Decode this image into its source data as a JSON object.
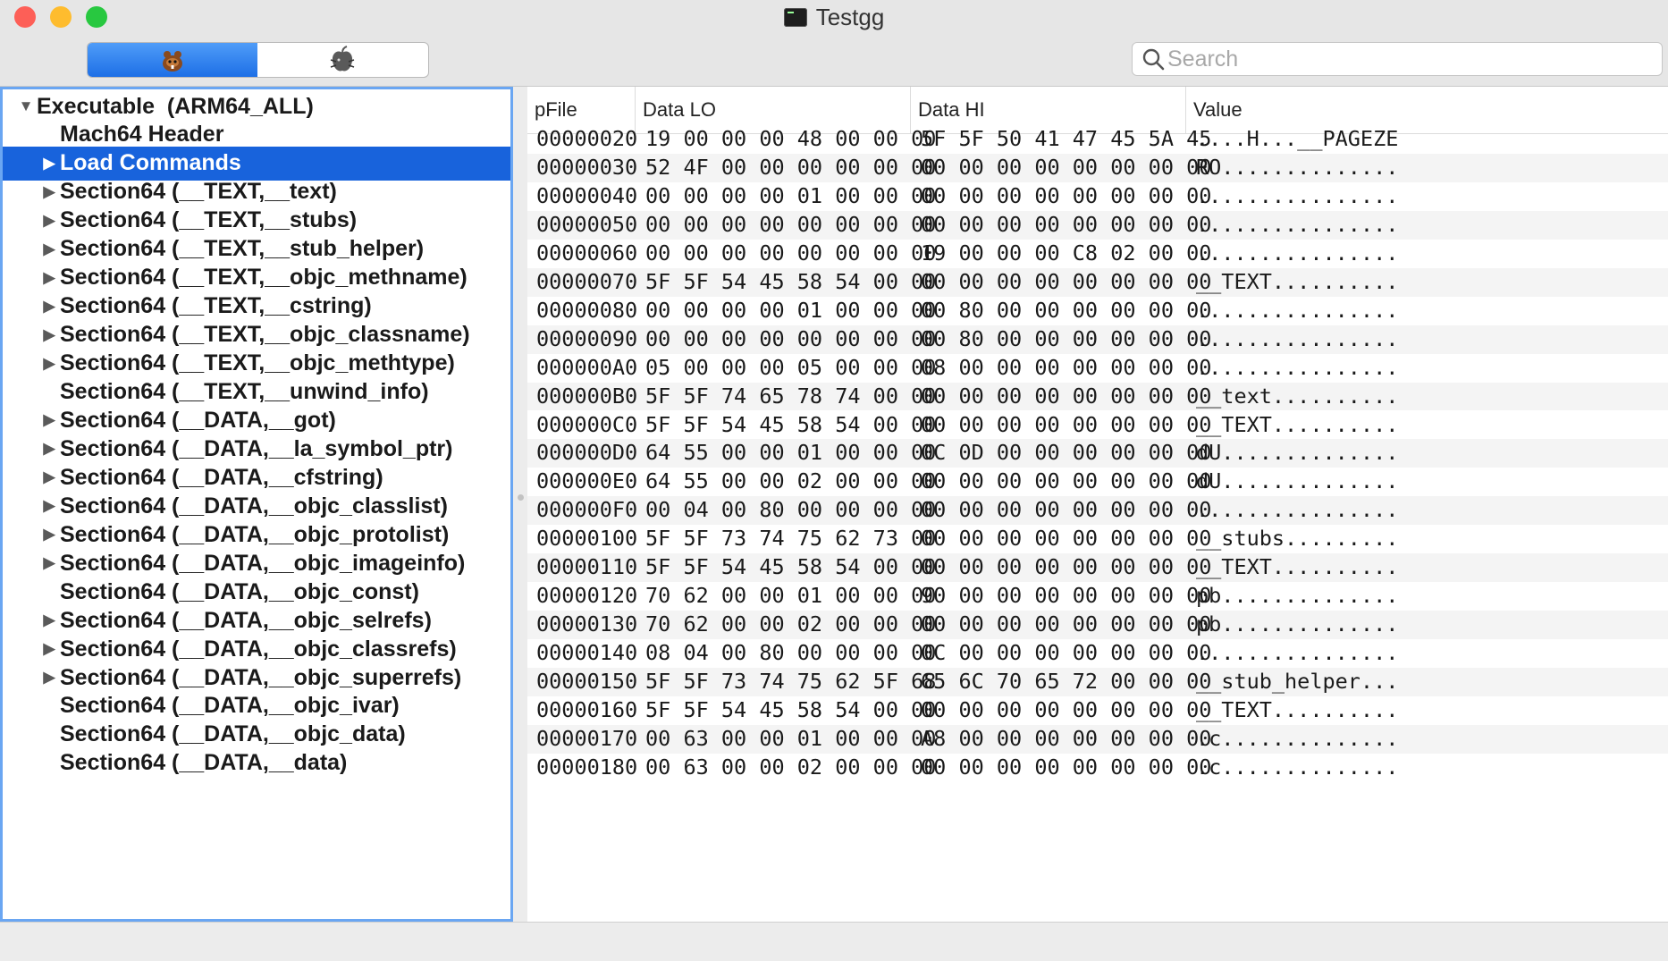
{
  "window": {
    "title": "Testgg"
  },
  "toolbar": {
    "segments": [
      {
        "icon": "rodent-icon",
        "active": true
      },
      {
        "icon": "apple-bug-icon",
        "active": false
      }
    ],
    "search_placeholder": "Search",
    "search_value": ""
  },
  "sidebar": {
    "items": [
      {
        "label": "Executable  (ARM64_ALL)",
        "level": 0,
        "disclosure": "expanded",
        "selected": false
      },
      {
        "label": "Mach64 Header",
        "level": 1,
        "disclosure": "none",
        "selected": false
      },
      {
        "label": "Load Commands",
        "level": 1,
        "disclosure": "collapsed",
        "selected": true
      },
      {
        "label": "Section64 (__TEXT,__text)",
        "level": 1,
        "disclosure": "collapsed",
        "selected": false
      },
      {
        "label": "Section64 (__TEXT,__stubs)",
        "level": 1,
        "disclosure": "collapsed",
        "selected": false
      },
      {
        "label": "Section64 (__TEXT,__stub_helper)",
        "level": 1,
        "disclosure": "collapsed",
        "selected": false
      },
      {
        "label": "Section64 (__TEXT,__objc_methname)",
        "level": 1,
        "disclosure": "collapsed",
        "selected": false
      },
      {
        "label": "Section64 (__TEXT,__cstring)",
        "level": 1,
        "disclosure": "collapsed",
        "selected": false
      },
      {
        "label": "Section64 (__TEXT,__objc_classname)",
        "level": 1,
        "disclosure": "collapsed",
        "selected": false
      },
      {
        "label": "Section64 (__TEXT,__objc_methtype)",
        "level": 1,
        "disclosure": "collapsed",
        "selected": false
      },
      {
        "label": "Section64 (__TEXT,__unwind_info)",
        "level": 1,
        "disclosure": "none",
        "selected": false
      },
      {
        "label": "Section64 (__DATA,__got)",
        "level": 1,
        "disclosure": "collapsed",
        "selected": false
      },
      {
        "label": "Section64 (__DATA,__la_symbol_ptr)",
        "level": 1,
        "disclosure": "collapsed",
        "selected": false
      },
      {
        "label": "Section64 (__DATA,__cfstring)",
        "level": 1,
        "disclosure": "collapsed",
        "selected": false
      },
      {
        "label": "Section64 (__DATA,__objc_classlist)",
        "level": 1,
        "disclosure": "collapsed",
        "selected": false
      },
      {
        "label": "Section64 (__DATA,__objc_protolist)",
        "level": 1,
        "disclosure": "collapsed",
        "selected": false
      },
      {
        "label": "Section64 (__DATA,__objc_imageinfo)",
        "level": 1,
        "disclosure": "collapsed",
        "selected": false
      },
      {
        "label": "Section64 (__DATA,__objc_const)",
        "level": 1,
        "disclosure": "none",
        "selected": false
      },
      {
        "label": "Section64 (__DATA,__objc_selrefs)",
        "level": 1,
        "disclosure": "collapsed",
        "selected": false
      },
      {
        "label": "Section64 (__DATA,__objc_classrefs)",
        "level": 1,
        "disclosure": "collapsed",
        "selected": false
      },
      {
        "label": "Section64 (__DATA,__objc_superrefs)",
        "level": 1,
        "disclosure": "collapsed",
        "selected": false
      },
      {
        "label": "Section64 (__DATA,__objc_ivar)",
        "level": 1,
        "disclosure": "none",
        "selected": false
      },
      {
        "label": "Section64 (__DATA,__objc_data)",
        "level": 1,
        "disclosure": "none",
        "selected": false
      },
      {
        "label": "Section64 (__DATA,__data)",
        "level": 1,
        "disclosure": "none",
        "selected": false
      }
    ]
  },
  "table": {
    "columns": [
      "pFile",
      "Data LO",
      "Data HI",
      "Value"
    ],
    "rows": [
      [
        "00000020",
        "19 00 00 00 48 00 00 00",
        "5F 5F 50 41 47 45 5A 45",
        "....H...__PAGEZE"
      ],
      [
        "00000030",
        "52 4F 00 00 00 00 00 00",
        "00 00 00 00 00 00 00 00",
        "RO.............."
      ],
      [
        "00000040",
        "00 00 00 00 01 00 00 00",
        "00 00 00 00 00 00 00 00",
        "................"
      ],
      [
        "00000050",
        "00 00 00 00 00 00 00 00",
        "00 00 00 00 00 00 00 00",
        "................"
      ],
      [
        "00000060",
        "00 00 00 00 00 00 00 00",
        "19 00 00 00 C8 02 00 00",
        "................"
      ],
      [
        "00000070",
        "5F 5F 54 45 58 54 00 00",
        "00 00 00 00 00 00 00 00",
        "__TEXT.........."
      ],
      [
        "00000080",
        "00 00 00 00 01 00 00 00",
        "00 80 00 00 00 00 00 00",
        "................"
      ],
      [
        "00000090",
        "00 00 00 00 00 00 00 00",
        "00 80 00 00 00 00 00 00",
        "................"
      ],
      [
        "000000A0",
        "05 00 00 00 05 00 00 00",
        "08 00 00 00 00 00 00 00",
        "................"
      ],
      [
        "000000B0",
        "5F 5F 74 65 78 74 00 00",
        "00 00 00 00 00 00 00 00",
        "__text.........."
      ],
      [
        "000000C0",
        "5F 5F 54 45 58 54 00 00",
        "00 00 00 00 00 00 00 00",
        "__TEXT.........."
      ],
      [
        "000000D0",
        "64 55 00 00 01 00 00 00",
        "0C 0D 00 00 00 00 00 00",
        "dU.............."
      ],
      [
        "000000E0",
        "64 55 00 00 02 00 00 00",
        "00 00 00 00 00 00 00 00",
        "dU.............."
      ],
      [
        "000000F0",
        "00 04 00 80 00 00 00 00",
        "00 00 00 00 00 00 00 00",
        "................"
      ],
      [
        "00000100",
        "5F 5F 73 74 75 62 73 00",
        "00 00 00 00 00 00 00 00",
        "__stubs........."
      ],
      [
        "00000110",
        "5F 5F 54 45 58 54 00 00",
        "00 00 00 00 00 00 00 00",
        "__TEXT.........."
      ],
      [
        "00000120",
        "70 62 00 00 01 00 00 00",
        "90 00 00 00 00 00 00 00",
        "pb.............."
      ],
      [
        "00000130",
        "70 62 00 00 02 00 00 00",
        "00 00 00 00 00 00 00 00",
        "pb.............."
      ],
      [
        "00000140",
        "08 04 00 80 00 00 00 00",
        "0C 00 00 00 00 00 00 00",
        "................"
      ],
      [
        "00000150",
        "5F 5F 73 74 75 62 5F 68",
        "65 6C 70 65 72 00 00 00",
        "__stub_helper..."
      ],
      [
        "00000160",
        "5F 5F 54 45 58 54 00 00",
        "00 00 00 00 00 00 00 00",
        "__TEXT.........."
      ],
      [
        "00000170",
        "00 63 00 00 01 00 00 00",
        "A8 00 00 00 00 00 00 00",
        ".c.............."
      ],
      [
        "00000180",
        "00 63 00 00 02 00 00 00",
        "00 00 00 00 00 00 00 00",
        ".c.............."
      ]
    ]
  },
  "colors": {
    "selection": "#1863dc",
    "sidebar_focus_ring": "#6aa6f2",
    "segment_active": "#1d6fe6",
    "row_alt": "#f4f4f4"
  }
}
